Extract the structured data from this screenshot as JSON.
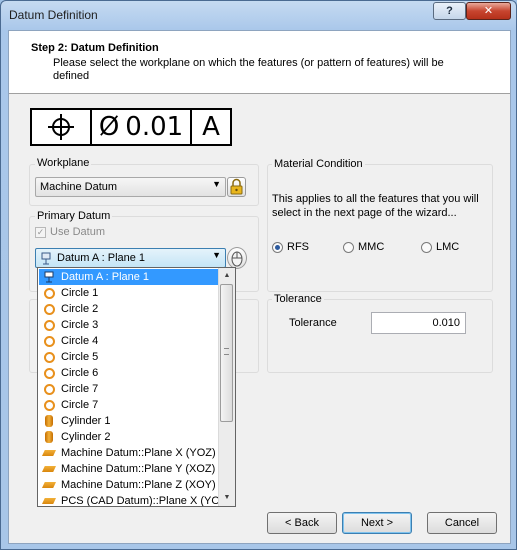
{
  "window": {
    "title": "Datum Definition",
    "help_label": "?",
    "close_label": "✕"
  },
  "header": {
    "step_title": "Step 2: Datum Definition",
    "description": "Please select the workplane on which the features (or pattern of features) will be defined"
  },
  "feature_control_frame": {
    "tolerance_value": "0.01",
    "datum_letter": "A"
  },
  "workplane": {
    "label": "Workplane",
    "selected": "Machine Datum"
  },
  "primary_datum": {
    "label": "Primary Datum",
    "use_datum_label": "Use Datum",
    "use_datum_checked": true,
    "selected": "Datum A : Plane 1"
  },
  "material_condition": {
    "label": "Material Condition",
    "description": "This applies to all the features that you will select in the next page of the wizard...",
    "options": [
      "RFS",
      "MMC",
      "LMC"
    ],
    "selected": "RFS"
  },
  "tolerance": {
    "group_label": "Tolerance",
    "field_label": "Tolerance",
    "value": "0.010"
  },
  "dropdown_items": [
    {
      "label": "Datum A : Plane 1",
      "icon": "datum-icon",
      "selected": true
    },
    {
      "label": "Circle 1",
      "icon": "circle-icon"
    },
    {
      "label": "Circle 2",
      "icon": "circle-icon"
    },
    {
      "label": "Circle 3",
      "icon": "circle-icon"
    },
    {
      "label": "Circle 4",
      "icon": "circle-icon"
    },
    {
      "label": "Circle 5",
      "icon": "circle-icon"
    },
    {
      "label": "Circle 6",
      "icon": "circle-icon"
    },
    {
      "label": "Circle 7",
      "icon": "circle-icon"
    },
    {
      "label": "Circle 7",
      "icon": "circle-icon"
    },
    {
      "label": "Cylinder 1",
      "icon": "cylinder-icon"
    },
    {
      "label": "Cylinder 2",
      "icon": "cylinder-icon"
    },
    {
      "label": "Machine Datum::Plane X (YOZ)",
      "icon": "plane-icon"
    },
    {
      "label": "Machine Datum::Plane Y (XOZ)",
      "icon": "plane-icon"
    },
    {
      "label": "Machine Datum::Plane Z (XOY)",
      "icon": "plane-icon"
    },
    {
      "label": "PCS (CAD Datum)::Plane X (YOZ)",
      "icon": "plane-icon"
    }
  ],
  "buttons": {
    "back": "< Back",
    "next": "Next >",
    "cancel": "Cancel"
  },
  "colors": {
    "selection": "#3399ff",
    "feature_icon": "#e8901c"
  }
}
